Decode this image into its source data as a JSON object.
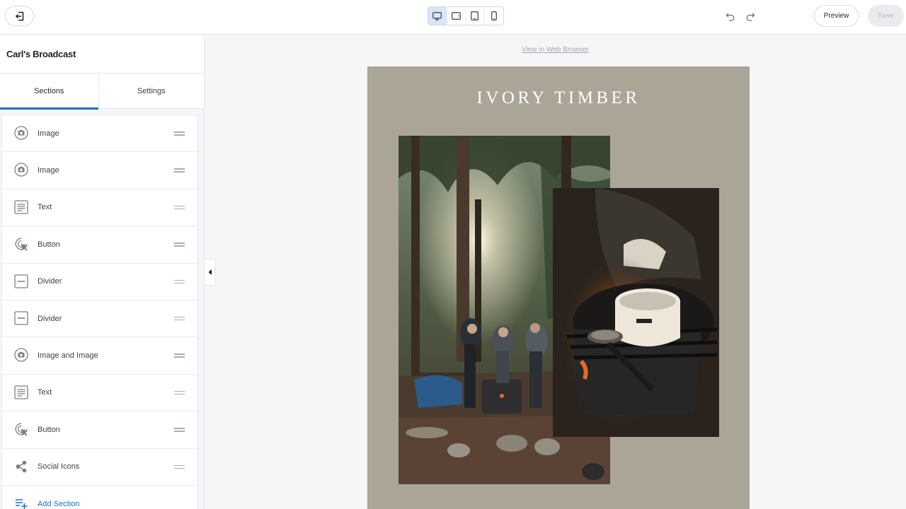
{
  "toolbar": {
    "exit_icon": "exit-icon",
    "devices": [
      "desktop-icon",
      "tablet-landscape-icon",
      "tablet-icon",
      "mobile-icon"
    ],
    "active_device": "desktop",
    "preview_label": "Preview",
    "save_label": "Save"
  },
  "sidebar": {
    "title": "Carl's Broadcast",
    "tabs": [
      {
        "label": "Sections",
        "active": true
      },
      {
        "label": "Settings",
        "active": false
      }
    ],
    "sections": [
      {
        "label": "Image",
        "icon": "camera-icon"
      },
      {
        "label": "Image",
        "icon": "camera-icon"
      },
      {
        "label": "Text",
        "icon": "text-block-icon"
      },
      {
        "label": "Button",
        "icon": "cursor-click-icon"
      },
      {
        "label": "Divider",
        "icon": "divider-icon"
      },
      {
        "label": "Divider",
        "icon": "divider-icon"
      },
      {
        "label": "Image and Image",
        "icon": "camera-icon"
      },
      {
        "label": "Text",
        "icon": "text-block-icon"
      },
      {
        "label": "Button",
        "icon": "cursor-click-icon"
      },
      {
        "label": "Social Icons",
        "icon": "share-icon"
      }
    ],
    "add_section_label": "Add Section"
  },
  "canvas": {
    "web_link": "View in Web Browser",
    "brand": "IVORY TIMBER",
    "accent": "#1a6fd1",
    "email_background": "#aba597"
  }
}
